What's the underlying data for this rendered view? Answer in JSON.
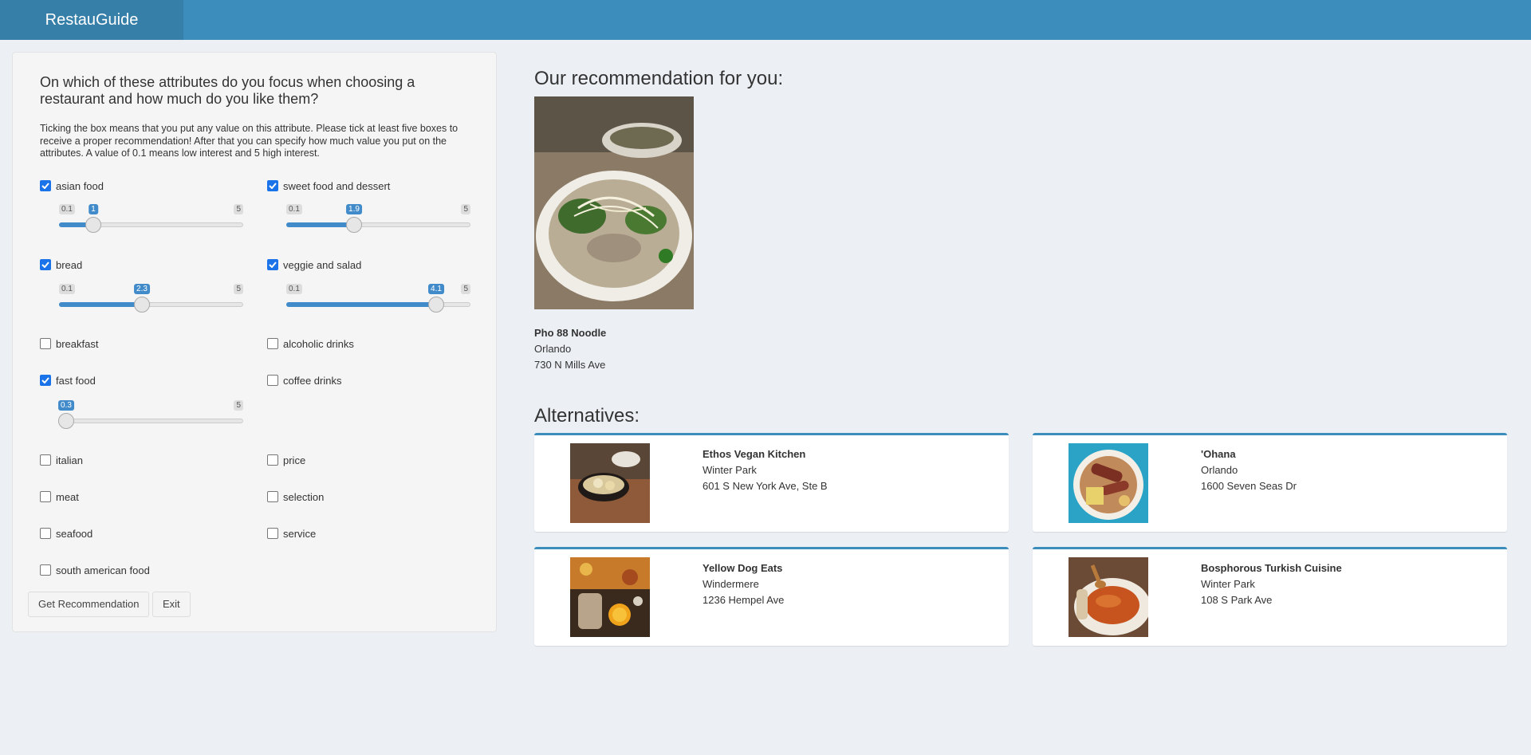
{
  "app": {
    "title": "RestauGuide"
  },
  "panel": {
    "question": "On which of these attributes do you focus when choosing a restaurant and how much do you like them?",
    "instructions": "Ticking the box means that you put any value on this attribute. Please tick at least five boxes to receive a proper recommendation! After that you can specify how much value you put on the attributes. A value of 0.1 means low interest and 5 high interest.",
    "attributes": [
      {
        "label": "asian food",
        "checked": true,
        "slider": {
          "min": "0.1",
          "max": "5",
          "value": "1",
          "fraction": 0.184
        }
      },
      {
        "label": "sweet food and dessert",
        "checked": true,
        "slider": {
          "min": "0.1",
          "max": "5",
          "value": "1.9",
          "fraction": 0.367
        }
      },
      {
        "label": "bread",
        "checked": true,
        "slider": {
          "min": "0.1",
          "max": "5",
          "value": "2.3",
          "fraction": 0.449
        }
      },
      {
        "label": "veggie and salad",
        "checked": true,
        "slider": {
          "min": "0.1",
          "max": "5",
          "value": "4.1",
          "fraction": 0.816
        }
      },
      {
        "label": "breakfast",
        "checked": false
      },
      {
        "label": "alcoholic drinks",
        "checked": false
      },
      {
        "label": "fast food",
        "checked": true,
        "slider": {
          "min": "",
          "max": "5",
          "value": "0.3",
          "fraction": 0.041
        }
      },
      {
        "label": "coffee drinks",
        "checked": false
      },
      {
        "label": "italian",
        "checked": false
      },
      {
        "label": "price",
        "checked": false
      },
      {
        "label": "meat",
        "checked": false
      },
      {
        "label": "selection",
        "checked": false
      },
      {
        "label": "seafood",
        "checked": false
      },
      {
        "label": "service",
        "checked": false
      },
      {
        "label": "south american food",
        "checked": false
      }
    ],
    "buttons": {
      "recommend": "Get Recommendation",
      "exit": "Exit"
    }
  },
  "recommendation": {
    "heading": "Our recommendation for you:",
    "name": "Pho 88 Noodle",
    "city": "Orlando",
    "address": "730 N Mills Ave"
  },
  "alternatives": {
    "heading": "Alternatives:",
    "items": [
      {
        "name": "Ethos Vegan Kitchen",
        "city": "Winter Park",
        "address": "601 S New York Ave, Ste B"
      },
      {
        "name": "'Ohana",
        "city": "Orlando",
        "address": "1600 Seven Seas Dr"
      },
      {
        "name": "Yellow Dog Eats",
        "city": "Windermere",
        "address": "1236 Hempel Ave"
      },
      {
        "name": "Bosphorous Turkish Cuisine",
        "city": "Winter Park",
        "address": "108 S Park Ave"
      }
    ]
  },
  "colors": {
    "header": "#3c8dbc",
    "logo_bg": "#367fa9",
    "slider": "#428bca",
    "checkbox": "#1a73e8"
  }
}
